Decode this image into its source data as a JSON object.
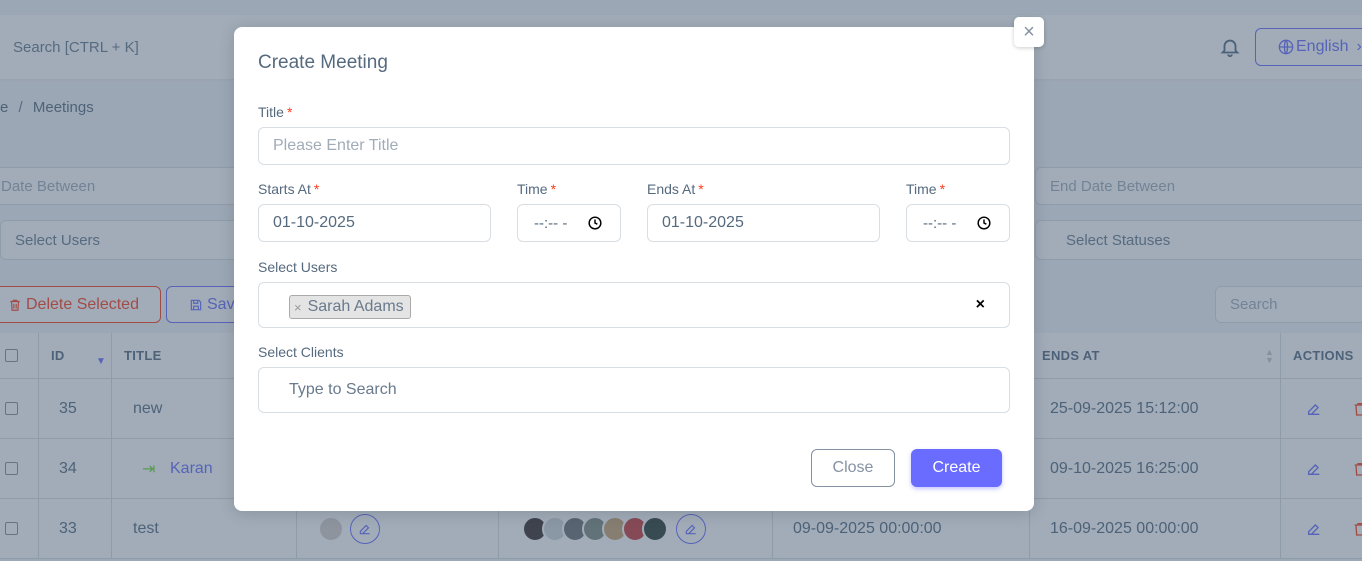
{
  "background": {
    "nav_search": "Search [CTRL + K]",
    "language": "English",
    "breadcrumb": {
      "prev": "e",
      "sep": "/",
      "current": "Meetings"
    },
    "filters": {
      "start_date": "Date Between",
      "end_date": "End Date Between",
      "users": "Select Users",
      "statuses": "Select Statuses"
    },
    "delete_selected": "Delete Selected",
    "save": "Save",
    "table_search": "Search",
    "columns": {
      "id": "ID",
      "title": "TITLE",
      "ends_at": "ENDS AT",
      "actions": "ACTIONS"
    },
    "rows": [
      {
        "id": "35",
        "title": "new",
        "starts_at": "",
        "ends_at": "25-09-2025 15:12:00"
      },
      {
        "id": "34",
        "title": "Karan",
        "starts_at": "",
        "ends_at": "09-10-2025 16:25:00"
      },
      {
        "id": "33",
        "title": "test",
        "starts_at": "09-09-2025 00:00:00",
        "ends_at": "16-09-2025 00:00:00"
      }
    ]
  },
  "modal": {
    "title": "Create Meeting",
    "close_x": "×",
    "fields": {
      "title_label": "Title",
      "title_placeholder": "Please Enter Title",
      "starts_at_label": "Starts At",
      "starts_at_value": "01-10-2025",
      "start_time_label": "Time",
      "start_time_value": "--:-- -",
      "ends_at_label": "Ends At",
      "ends_at_value": "01-10-2025",
      "end_time_label": "Time",
      "end_time_value": "--:-- -",
      "users_label": "Select Users",
      "users_selected": "Sarah Adams",
      "tag_remove": "×",
      "clear_all": "×",
      "clients_label": "Select Clients",
      "clients_placeholder": "Type to Search"
    },
    "required_mark": "*",
    "close_button": "Close",
    "create_button": "Create"
  },
  "colors": {
    "primary": "#696cff",
    "danger": "#ff3e1d",
    "secondary": "#8592a3"
  }
}
